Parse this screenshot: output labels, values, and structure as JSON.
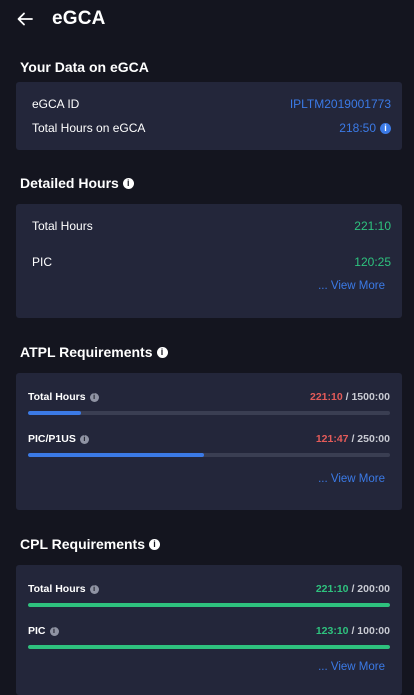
{
  "header": {
    "title": "eGCA"
  },
  "your_data": {
    "title": "Your Data on eGCA",
    "rows": [
      {
        "label": "eGCA ID",
        "value": "IPLTM2019001773"
      },
      {
        "label": "Total Hours on eGCA",
        "value": "218:50"
      }
    ]
  },
  "detailed": {
    "title": "Detailed Hours",
    "rows": [
      {
        "label": "Total Hours",
        "value": "221:10"
      },
      {
        "label": "PIC",
        "value": "120:25"
      }
    ],
    "view_more": "... View More"
  },
  "atpl": {
    "title": "ATPL Requirements",
    "items": [
      {
        "label": "Total Hours",
        "value": "221:10",
        "sep": "/",
        "target": "1500:00",
        "progress": 0.147
      },
      {
        "label": "PIC/P1US",
        "value": "121:47",
        "sep": "/",
        "target": "250:00",
        "progress": 0.487
      }
    ],
    "view_more": "... View More"
  },
  "cpl": {
    "title": "CPL Requirements",
    "items": [
      {
        "label": "Total Hours",
        "value": "221:10",
        "sep": "/",
        "target": "200:00",
        "progress": 1.0
      },
      {
        "label": "PIC",
        "value": "123:10",
        "sep": "/",
        "target": "100:00",
        "progress": 1.0
      }
    ],
    "view_more": "... View More"
  },
  "colors": {
    "blue": "#3b7ae6",
    "green": "#2ec27e",
    "red": "#e35b59",
    "card": "#23263a",
    "background": "#14151f"
  },
  "icons": {
    "back": "arrow-left-icon",
    "info": "info-icon"
  }
}
